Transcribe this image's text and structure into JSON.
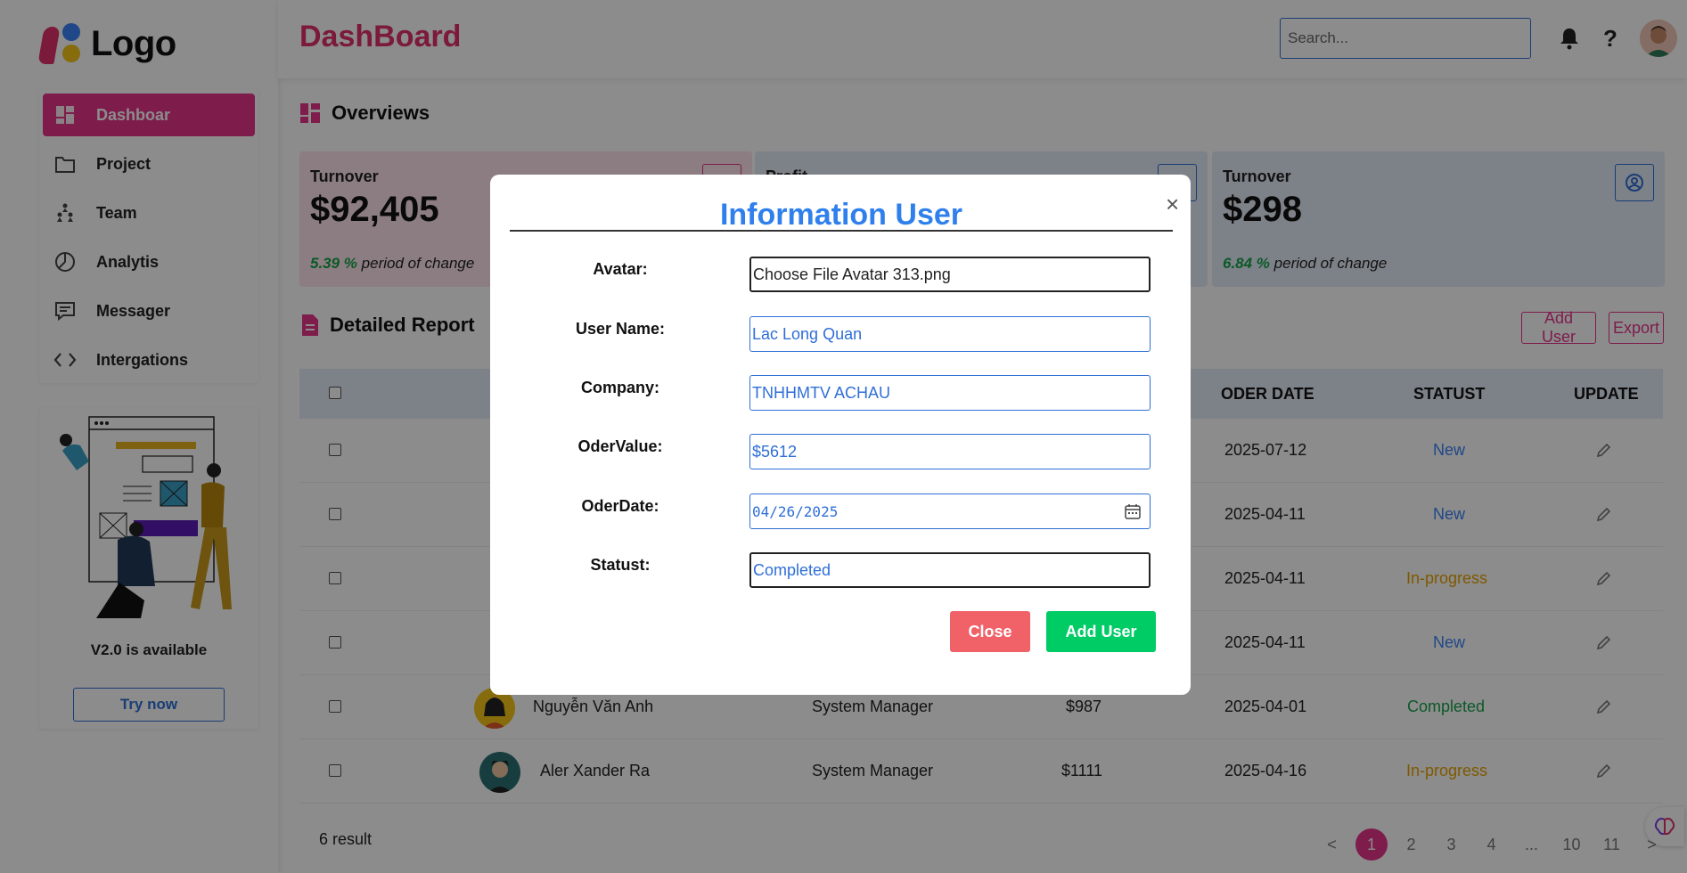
{
  "app": {
    "logo_text": "Logo",
    "page_title": "DashBoard"
  },
  "header": {
    "search_placeholder": "Search...",
    "icons": [
      "bell-icon",
      "help-icon",
      "avatar"
    ]
  },
  "sidebar": {
    "items": [
      {
        "label": "Dashboar",
        "icon": "dashboard-icon",
        "active": true
      },
      {
        "label": "Project",
        "icon": "folder-icon"
      },
      {
        "label": "Team",
        "icon": "team-icon"
      },
      {
        "label": "Analytis",
        "icon": "pie-chart-icon"
      },
      {
        "label": "Messager",
        "icon": "message-icon"
      },
      {
        "label": "Intergations",
        "icon": "code-icon"
      }
    ],
    "promo_title": "V2.0 is available",
    "promo_button": "Try now"
  },
  "overview": {
    "title": "Overviews",
    "cards": [
      {
        "label": "Turnover",
        "value": "$92,405",
        "change": "5.39 %",
        "suffix": "period of change"
      },
      {
        "label": "Profit",
        "value": "",
        "change": "",
        "suffix": ""
      },
      {
        "label": "Turnover",
        "value": "$298",
        "change": "6.84 %",
        "suffix": "period of change"
      }
    ]
  },
  "report": {
    "title": "Detailed Report",
    "add_user": "Add User",
    "export": "Export",
    "columns": [
      "ODER DATE",
      "STATUST",
      "UPDATE"
    ],
    "rows": [
      {
        "name": "",
        "company": "",
        "value": "",
        "date": "2025-07-12",
        "status": "New"
      },
      {
        "name": "",
        "company": "",
        "value": "",
        "date": "2025-04-11",
        "status": "New"
      },
      {
        "name": "",
        "company": "",
        "value": "",
        "date": "2025-04-11",
        "status": "In-progress"
      },
      {
        "name": "",
        "company": "",
        "value": "",
        "date": "2025-04-11",
        "status": "New"
      },
      {
        "name": "Nguyễn Văn Anh",
        "company": "System Manager",
        "value": "$987",
        "date": "2025-04-01",
        "status": "Completed"
      },
      {
        "name": "Aler Xander Ra",
        "company": "System Manager",
        "value": "$1111",
        "date": "2025-04-16",
        "status": "In-progress"
      }
    ],
    "result": "6 result",
    "pagination": [
      "<",
      "1",
      "2",
      "3",
      "4",
      "...",
      "10",
      "11",
      ">"
    ]
  },
  "modal": {
    "title": "Information User",
    "close_x": "×",
    "fields": {
      "avatar_label": "Avatar:",
      "avatar_value": "Choose File Avatar 313.png",
      "username_label": "User Name:",
      "username_value": "Lac Long Quan",
      "company_label": "Company:",
      "company_value": "TNHHMTV ACHAU",
      "odervalue_label": "OderValue:",
      "odervalue_value": "$5612",
      "oderdate_label": "OderDate:",
      "oderdate_value": "04/26/2025",
      "statust_label": "Statust:",
      "statust_value": "Completed"
    },
    "close_button": "Close",
    "add_button": "Add User"
  },
  "colors": {
    "accent": "#e6338a",
    "primary_blue": "#2f6fd6",
    "close_btn": "#f06168",
    "add_btn": "#00cc66",
    "completed": "#16a34a",
    "in_progress": "#e6a300",
    "new": "#3b82f6"
  }
}
